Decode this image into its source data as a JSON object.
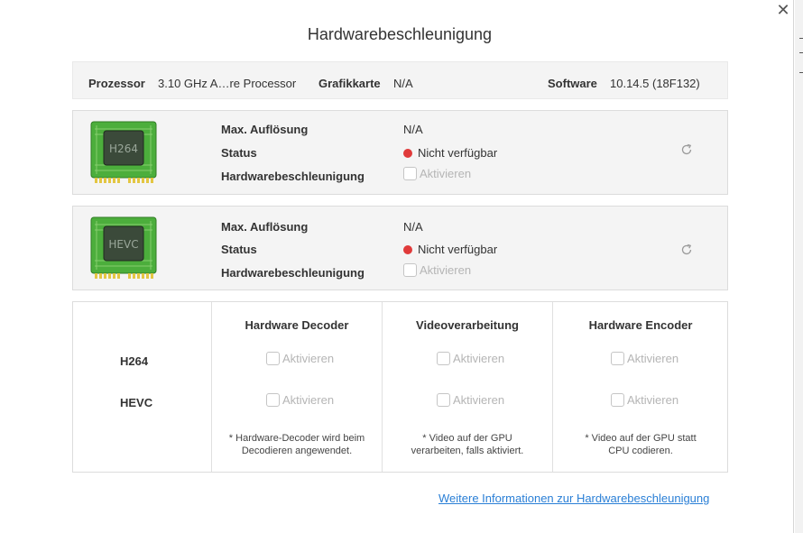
{
  "dialog": {
    "title": "Hardwarebeschleunigung",
    "close_glyph": "✕"
  },
  "info": {
    "processor_label": "Prozessor",
    "processor_value": "3.10 GHz A…re Processor",
    "gpu_label": "Grafikkarte",
    "gpu_value": "N/A",
    "software_label": "Software",
    "software_value": "10.14.5 (18F132)"
  },
  "codecs": [
    {
      "chip_text": "H264",
      "max_res_label": "Max. Auflösung",
      "max_res_value": "N/A",
      "status_label": "Status",
      "status_value": "Nicht verfügbar",
      "hw_label": "Hardwarebeschleunigung",
      "enable_label": "Aktivieren"
    },
    {
      "chip_text": "HEVC",
      "max_res_label": "Max. Auflösung",
      "max_res_value": "N/A",
      "status_label": "Status",
      "status_value": "Nicht verfügbar",
      "hw_label": "Hardwarebeschleunigung",
      "enable_label": "Aktivieren"
    }
  ],
  "matrix": {
    "columns": [
      "Hardware Decoder",
      "Videoverarbeitung",
      "Hardware Encoder"
    ],
    "rows": [
      "H264",
      "HEVC"
    ],
    "enable_label": "Aktivieren",
    "notes": [
      [
        "* Hardware-Decoder wird beim",
        "Decodieren angewendet."
      ],
      [
        "* Video auf der GPU",
        "verarbeiten, falls aktiviert."
      ],
      [
        "* Video auf der GPU statt",
        "CPU codieren."
      ]
    ]
  },
  "link_text": "Weitere Informationen zur Hardwarebeschleunigung",
  "colors": {
    "status_unavailable": "#e03a3a",
    "link": "#2a7fd6",
    "chip_board": "#4cae3c",
    "chip_body": "#3b4a3a"
  },
  "icons": [
    "close-icon",
    "chip-icon",
    "status-dot-icon",
    "refresh-icon",
    "checkbox"
  ]
}
